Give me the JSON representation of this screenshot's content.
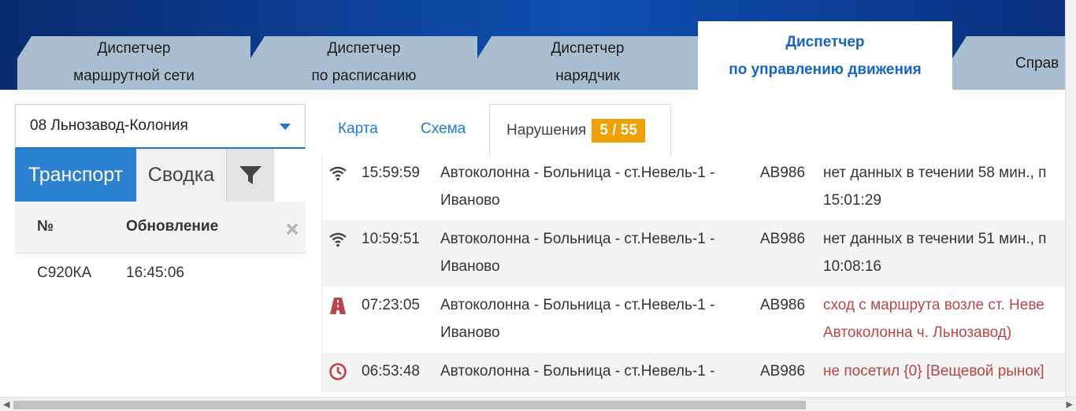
{
  "nav": {
    "tabs": [
      {
        "line1": "Диспетчер",
        "line2": "маршрутной сети"
      },
      {
        "line1": "Диспетчер",
        "line2": "по расписанию"
      },
      {
        "line1": "Диспетчер",
        "line2": "нарядчик"
      },
      {
        "line1": "Диспетчер",
        "line2": "по управлению движения"
      },
      {
        "line1": "Справ",
        "line2": ""
      }
    ]
  },
  "route_select": {
    "value": "08 Льнозавод-Колония"
  },
  "left_tabs": {
    "transport": "Транспорт",
    "summary": "Сводка"
  },
  "left_table": {
    "headers": {
      "number": "№",
      "update": "Обновление"
    },
    "rows": [
      {
        "number": "С920КА",
        "update": "16:45:06"
      }
    ]
  },
  "right_tabs": {
    "map": "Карта",
    "scheme": "Схема",
    "violations": "Нарушения",
    "badge": "5 / 55"
  },
  "violations": [
    {
      "icon": "wifi-signal-icon",
      "time": "15:59:59",
      "route_line1": "Автоколонна - Больница - ст.Невель-1 -",
      "route_line2": "Иваново",
      "plate": "АВ986",
      "msg_line1": "нет данных в течении 58 мин., п",
      "msg_line2": "15:01:29"
    },
    {
      "icon": "wifi-signal-icon",
      "time": "10:59:51",
      "route_line1": "Автоколонна - Больница - ст.Невель-1 -",
      "route_line2": "Иваново",
      "plate": "АВ986",
      "msg_line1": "нет данных в течении 51 мин., п",
      "msg_line2": "10:08:16"
    },
    {
      "icon": "road-icon",
      "time": "07:23:05",
      "route_line1": "Автоколонна - Больница - ст.Невель-1 -",
      "route_line2": "Иваново",
      "plate": "АВ986",
      "msg_line1": "сход с маршрута возле ст. Неве",
      "msg_line2": "Автоколонна ч. Льнозавод)"
    },
    {
      "icon": "clock-icon",
      "time": "06:53:48",
      "route_line1": "Автоколонна - Больница - ст.Невель-1 -",
      "route_line2": "",
      "plate": "АВ986",
      "msg_line1": "не посетил {0} [Вещевой рынок]",
      "msg_line2": ""
    }
  ],
  "colors": {
    "accent_blue": "#2b80cf",
    "badge_orange": "#f0a000",
    "alert_red": "#b9454a"
  }
}
